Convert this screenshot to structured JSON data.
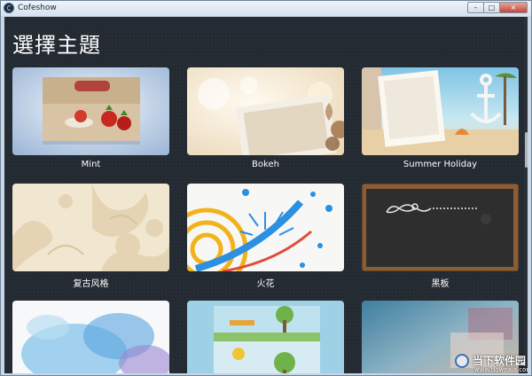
{
  "window": {
    "title": "Cofeshow",
    "controls": {
      "minimize": "–",
      "maximize": "□",
      "close": "×"
    }
  },
  "page": {
    "heading": "選擇主題"
  },
  "themes": [
    {
      "label": "Mint"
    },
    {
      "label": "Bokeh"
    },
    {
      "label": "Summer Holiday"
    },
    {
      "label": "复古风格"
    },
    {
      "label": "火花"
    },
    {
      "label": "黑板"
    },
    {
      "label": ""
    },
    {
      "label": ""
    },
    {
      "label": ""
    }
  ],
  "watermark": {
    "text": "当下软件园",
    "url": "www.downxia.com"
  }
}
